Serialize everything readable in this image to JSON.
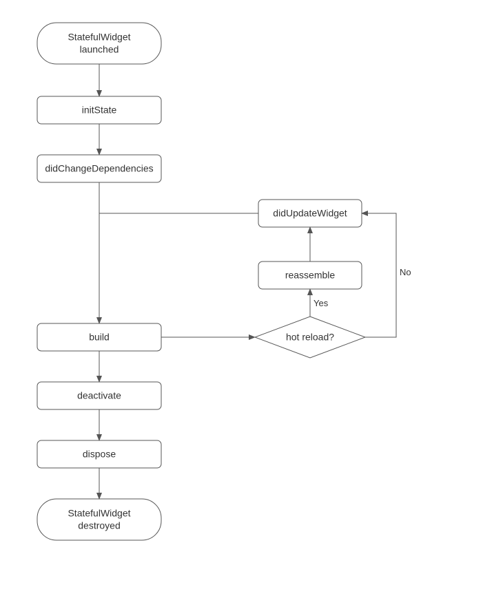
{
  "nodes": {
    "start": {
      "line1": "StatefulWidget",
      "line2": "launched"
    },
    "initState": "initState",
    "didChangeDependencies": "didChangeDependencies",
    "build": "build",
    "deactivate": "deactivate",
    "dispose": "dispose",
    "end": {
      "line1": "StatefulWidget",
      "line2": "destroyed"
    },
    "hotReload": "hot reload?",
    "reassemble": "reassemble",
    "didUpdateWidget": "didUpdateWidget"
  },
  "edges": {
    "yes": "Yes",
    "no": "No"
  }
}
